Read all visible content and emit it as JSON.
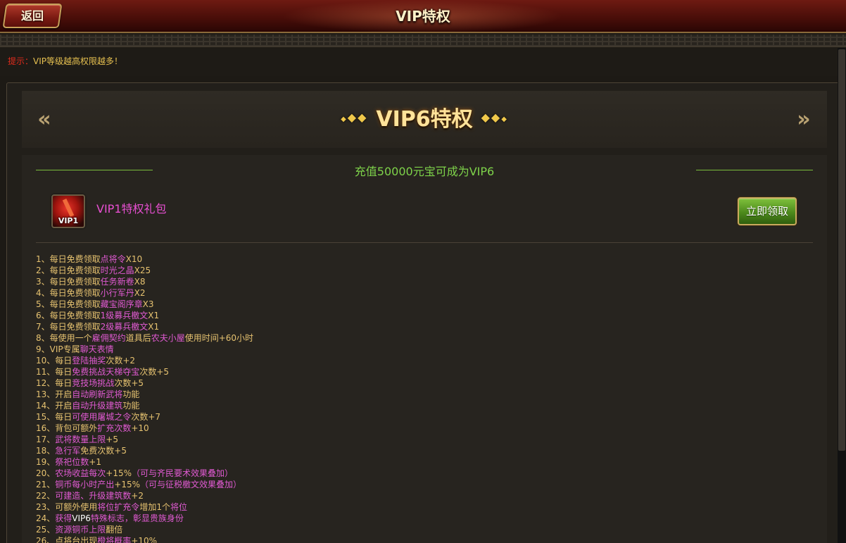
{
  "header": {
    "back_label": "返回",
    "title": "VIP特权"
  },
  "tip": {
    "label": "提示：",
    "text": "VIP等级越高权限越多！"
  },
  "vip_panel": {
    "title": "VIP6特权",
    "prev_arrow": "«",
    "next_arrow": "»",
    "recharge_text": "充值50000元宝可成为VIP6",
    "gift": {
      "icon_tag": "VIP1",
      "name": "VIP1特权礼包",
      "claim_label": "立即领取"
    }
  },
  "perks": [
    [
      [
        "n",
        "1、"
      ],
      [
        "t",
        "每日免费领取"
      ],
      [
        "h",
        "点将令"
      ],
      [
        "t",
        "X10"
      ]
    ],
    [
      [
        "n",
        "2、"
      ],
      [
        "t",
        "每日免费领取"
      ],
      [
        "h",
        "时光之晶"
      ],
      [
        "t",
        "X25"
      ]
    ],
    [
      [
        "n",
        "3、"
      ],
      [
        "t",
        "每日免费领取"
      ],
      [
        "h",
        "任务新卷"
      ],
      [
        "t",
        "X8"
      ]
    ],
    [
      [
        "n",
        "4、"
      ],
      [
        "t",
        "每日免费领取"
      ],
      [
        "h",
        "小行军丹"
      ],
      [
        "t",
        "X2"
      ]
    ],
    [
      [
        "n",
        "5、"
      ],
      [
        "t",
        "每日免费领取"
      ],
      [
        "h",
        "藏宝阁序章"
      ],
      [
        "t",
        "X3"
      ]
    ],
    [
      [
        "n",
        "6、"
      ],
      [
        "t",
        "每日免费领取"
      ],
      [
        "h",
        "1级募兵檄文"
      ],
      [
        "t",
        "X1"
      ]
    ],
    [
      [
        "n",
        "7、"
      ],
      [
        "t",
        "每日免费领取"
      ],
      [
        "h",
        "2级募兵檄文"
      ],
      [
        "t",
        "X1"
      ]
    ],
    [
      [
        "n",
        "8、"
      ],
      [
        "t",
        "每使用一个"
      ],
      [
        "h",
        "雇佣契约"
      ],
      [
        "t",
        "道具后"
      ],
      [
        "h",
        "农夫小屋"
      ],
      [
        "t",
        "使用时间+60小时"
      ]
    ],
    [
      [
        "n",
        "9、"
      ],
      [
        "t",
        "VIP专属"
      ],
      [
        "h",
        "聊天表情"
      ]
    ],
    [
      [
        "n",
        "10、"
      ],
      [
        "t",
        "每日"
      ],
      [
        "h",
        "登陆抽奖"
      ],
      [
        "t",
        "次数+2"
      ]
    ],
    [
      [
        "n",
        "11、"
      ],
      [
        "t",
        "每日"
      ],
      [
        "h",
        "免费挑战天梯夺宝"
      ],
      [
        "t",
        "次数+5"
      ]
    ],
    [
      [
        "n",
        "12、"
      ],
      [
        "t",
        "每日"
      ],
      [
        "h",
        "竞技场挑战"
      ],
      [
        "t",
        "次数+5"
      ]
    ],
    [
      [
        "n",
        "13、"
      ],
      [
        "t",
        "开启"
      ],
      [
        "h",
        "自动刷新武将"
      ],
      [
        "t",
        "功能"
      ]
    ],
    [
      [
        "n",
        "14、"
      ],
      [
        "t",
        "开启"
      ],
      [
        "h",
        "自动升级建筑"
      ],
      [
        "t",
        "功能"
      ]
    ],
    [
      [
        "n",
        "15、"
      ],
      [
        "t",
        "每日"
      ],
      [
        "h",
        "可使用屠城之令"
      ],
      [
        "t",
        "次数+7"
      ]
    ],
    [
      [
        "n",
        "16、"
      ],
      [
        "t",
        "背包可额外"
      ],
      [
        "h",
        "扩充次数"
      ],
      [
        "t",
        "+10"
      ]
    ],
    [
      [
        "n",
        "17、"
      ],
      [
        "h",
        "武将数量上限"
      ],
      [
        "t",
        "+5"
      ]
    ],
    [
      [
        "n",
        "18、"
      ],
      [
        "h",
        "急行军"
      ],
      [
        "t",
        "免费次数+5"
      ]
    ],
    [
      [
        "n",
        "19、"
      ],
      [
        "h",
        "祭祀位数"
      ],
      [
        "t",
        "+1"
      ]
    ],
    [
      [
        "n",
        "20、"
      ],
      [
        "h",
        "农场收益每次"
      ],
      [
        "t",
        "+15%"
      ],
      [
        "h",
        "（可与齐民要术效果叠加）"
      ]
    ],
    [
      [
        "n",
        "21、"
      ],
      [
        "h",
        "铜币每小时产出"
      ],
      [
        "t",
        "+15%"
      ],
      [
        "h",
        "（可与征税檄文效果叠加）"
      ]
    ],
    [
      [
        "n",
        "22、"
      ],
      [
        "h",
        "可建造、升级建筑数"
      ],
      [
        "t",
        "+2"
      ]
    ],
    [
      [
        "n",
        "23、"
      ],
      [
        "t",
        "可额外使用"
      ],
      [
        "h",
        "将位扩充令"
      ],
      [
        "t",
        "增加1个"
      ],
      [
        "h",
        "将位"
      ]
    ],
    [
      [
        "n",
        "24、"
      ],
      [
        "h",
        "获得"
      ],
      [
        "w",
        "VIP6"
      ],
      [
        "h",
        "特殊标志，彰显贵族身份"
      ]
    ],
    [
      [
        "n",
        "25、"
      ],
      [
        "h",
        "资源铜币上限"
      ],
      [
        "t",
        "翻倍"
      ]
    ],
    [
      [
        "n",
        "26、"
      ],
      [
        "t",
        "点将台出现"
      ],
      [
        "h",
        "橙将概率"
      ],
      [
        "t",
        "+10%"
      ]
    ]
  ]
}
